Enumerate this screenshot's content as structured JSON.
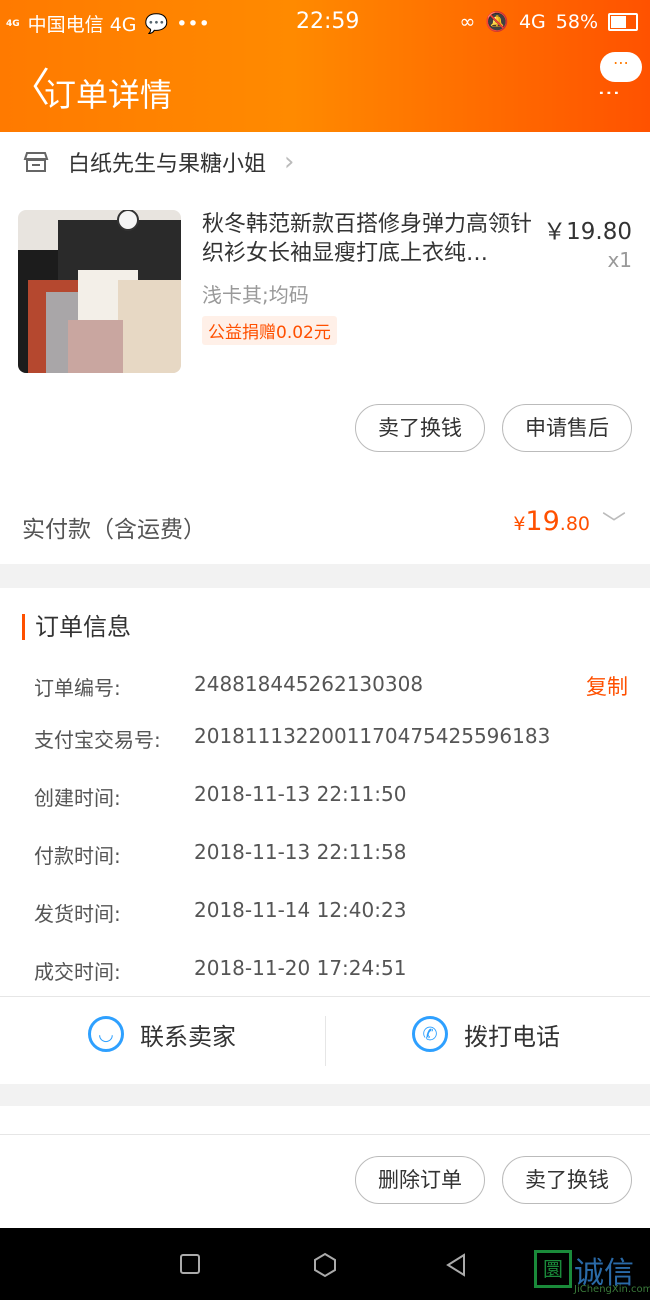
{
  "status_bar": {
    "signal": "4G",
    "carrier": "中国电信 4G",
    "dots": "•••",
    "time": "22:59",
    "network": "4G",
    "battery": "58%"
  },
  "header": {
    "back_glyph": "〈",
    "title": "订单详情",
    "more_dots": "⋯"
  },
  "shop": {
    "name": "白纸先生与果糖小姐"
  },
  "product": {
    "title": "秋冬韩范新款百搭修身弹力高领针织衫女长袖显瘦打底上衣纯…",
    "price": "￥19.80",
    "quantity": "x1",
    "sku": "浅卡其;均码",
    "charity_tag": "公益捐赠0.02元"
  },
  "product_actions": {
    "sell_button": "卖了换钱",
    "aftersale_button": "申请售后"
  },
  "payment": {
    "label": "实付款（含运费）",
    "currency": "¥",
    "integer": "19",
    "decimal": ".80"
  },
  "order_info": {
    "heading": "订单信息",
    "copy_label": "复制",
    "rows": [
      {
        "label": "订单编号:",
        "value": "248818445262130308"
      },
      {
        "label": "支付宝交易号:",
        "value": "2018111322001170475425596183"
      },
      {
        "label": "创建时间:",
        "value": "2018-11-13 22:11:50"
      },
      {
        "label": "付款时间:",
        "value": "2018-11-13 22:11:58"
      },
      {
        "label": "发货时间:",
        "value": "2018-11-14 12:40:23"
      },
      {
        "label": "成交时间:",
        "value": "2018-11-20 17:24:51"
      }
    ]
  },
  "contact": {
    "contact_seller": "联系卖家",
    "call_phone": "拨打电话"
  },
  "bottom_actions": {
    "delete_order": "删除订单",
    "sell_button": "卖了换钱"
  },
  "watermark": {
    "logo_char": "圜",
    "text": "诚信",
    "sub": "JiChengXin.com"
  },
  "colors": {
    "accent": "#ff5000",
    "header_start": "#ff7a00",
    "header_end": "#ff5200",
    "contact_icon": "#2ea0ff"
  }
}
